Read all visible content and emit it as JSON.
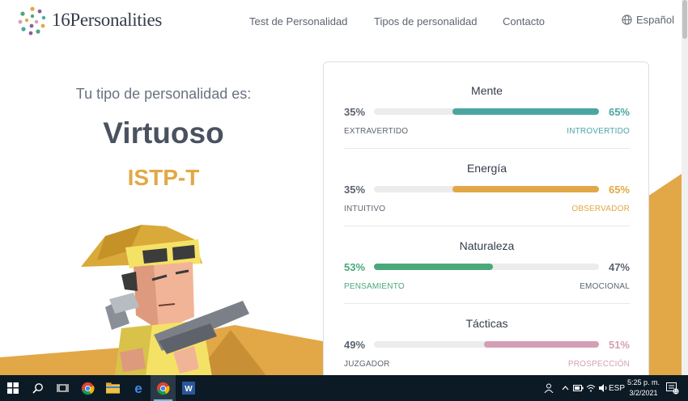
{
  "header": {
    "brand": "16Personalities",
    "nav": {
      "test": "Test de Personalidad",
      "tipos": "Tipos de personalidad",
      "contacto": "Contacto"
    },
    "language": "Español"
  },
  "hero": {
    "intro": "Tu tipo de personalidad es:",
    "type_name": "Virtuoso",
    "type_code": "ISTP-T"
  },
  "traits": [
    {
      "title": "Mente",
      "left_pct": "35%",
      "right_pct": "65%",
      "left_label": "EXTRAVERTIDO",
      "right_label": "INTROVERTIDO",
      "dominant": "right",
      "dominant_fraction": 0.65,
      "color": "#4ba6a2"
    },
    {
      "title": "Energía",
      "left_pct": "35%",
      "right_pct": "65%",
      "left_label": "INTUITIVO",
      "right_label": "OBSERVADOR",
      "dominant": "right",
      "dominant_fraction": 0.65,
      "color": "#e2a847"
    },
    {
      "title": "Naturaleza",
      "left_pct": "53%",
      "right_pct": "47%",
      "left_label": "PENSAMIENTO",
      "right_label": "EMOCIONAL",
      "dominant": "left",
      "dominant_fraction": 0.53,
      "color": "#4aa87a"
    },
    {
      "title": "Tácticas",
      "left_pct": "49%",
      "right_pct": "51%",
      "left_label": "JUZGADOR",
      "right_label": "PROSPECCIÓN",
      "dominant": "right",
      "dominant_fraction": 0.51,
      "color": "#d49fb4"
    }
  ],
  "neutral_text_color": "#5c6470",
  "taskbar": {
    "icons": [
      "windows-start-icon",
      "search-icon",
      "task-view-icon",
      "chrome-icon",
      "file-explorer-icon",
      "edge-icon",
      "chrome-icon",
      "word-icon"
    ],
    "tray_lang": "ESP",
    "time": "5:25 p. m.",
    "date": "3/2/2021",
    "notification_count": "11"
  }
}
